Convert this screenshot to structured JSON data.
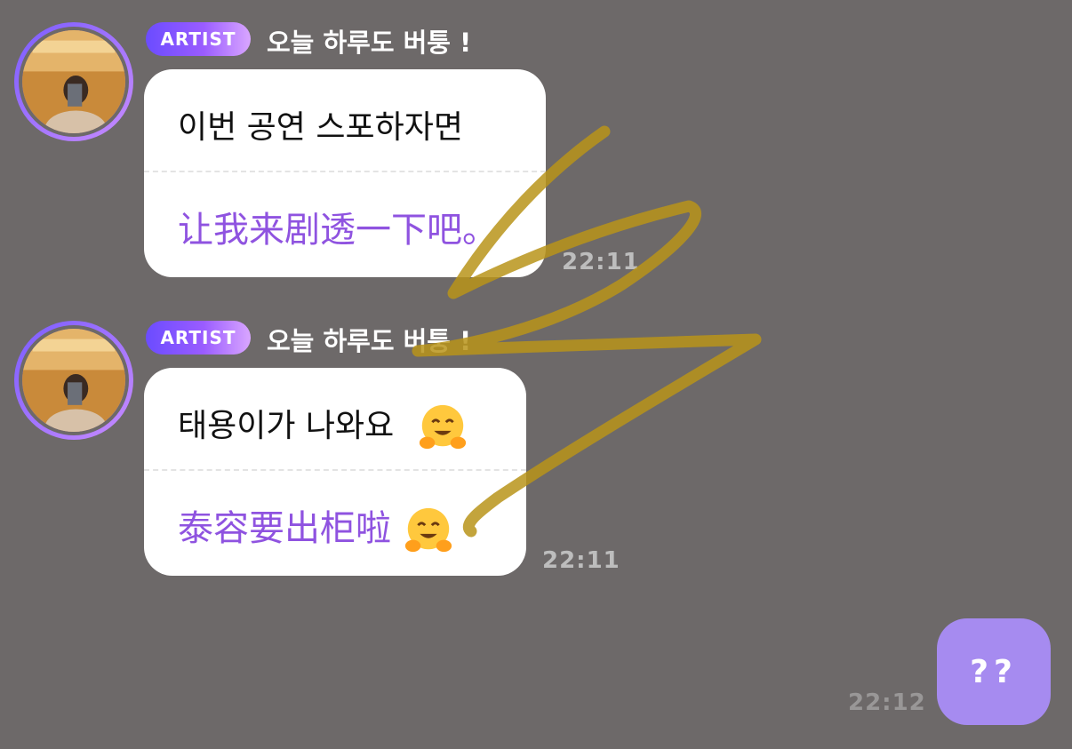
{
  "messages": [
    {
      "badge": "ARTIST",
      "sender": "오늘 하루도 버퉁 !",
      "korean": "이번 공연 스포하자면",
      "chinese": "让我来剧透一下吧。",
      "time": "22:11"
    },
    {
      "badge": "ARTIST",
      "sender": "오늘 하루도 버퉁 !",
      "korean": "태용이가 나와요",
      "korean_emoji": "hugging-face-emoji",
      "chinese": "泰容要出柜啦",
      "chinese_emoji": "hugging-face-emoji",
      "time": "22:11"
    }
  ],
  "my_message": {
    "text": "??",
    "time": "22:12"
  },
  "colors": {
    "background": "#6d6969",
    "bubble": "#ffffff",
    "translation_text": "#8f53e0",
    "my_bubble": "#a68bf0",
    "badge_gradient_start": "#6b4cff",
    "scribble": "#b8941a"
  }
}
